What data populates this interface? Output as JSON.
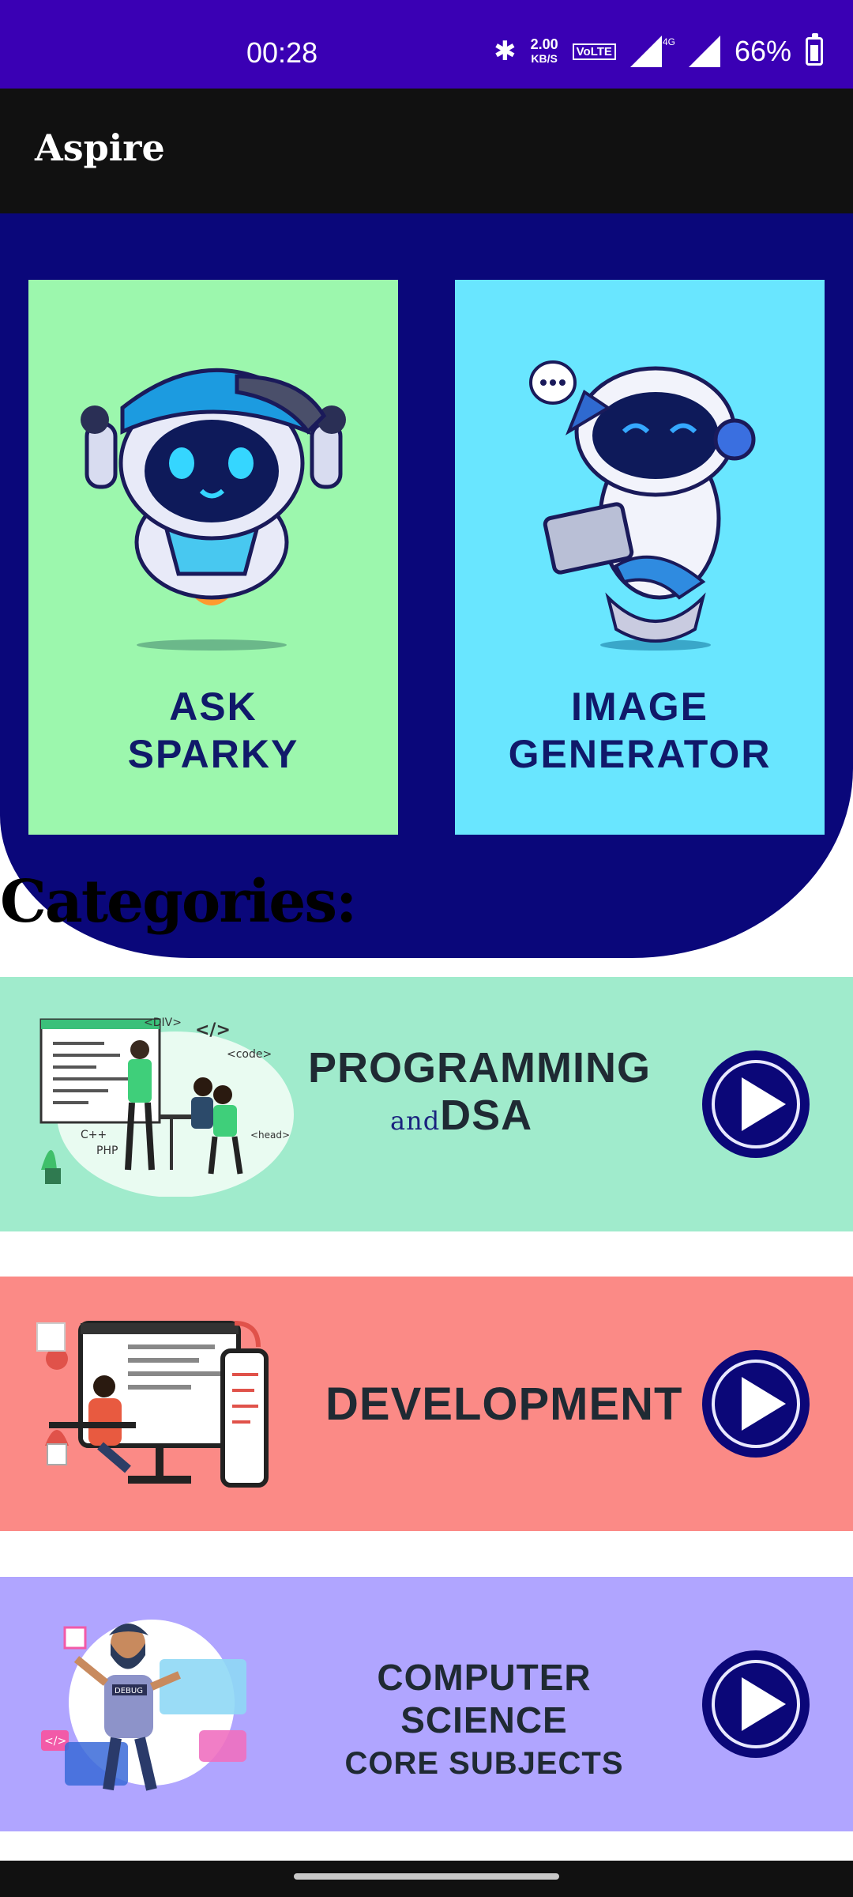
{
  "status_bar": {
    "time": "00:28",
    "data_speed": "2.00",
    "data_unit": "KB/S",
    "volte_label": "Vo LTE 2",
    "network": "4G+",
    "battery": "66%",
    "bg_color": "#3a00b4"
  },
  "app_bar": {
    "title": "Aspire"
  },
  "hero": {
    "cards": [
      {
        "line1": "ASK",
        "line2": "SPARKY",
        "bg": "#9cf7ad",
        "icon": "rocket-robot-icon"
      },
      {
        "line1": "IMAGE",
        "line2": "GENERATOR",
        "bg": "#69e6ff",
        "icon": "laptop-robot-icon"
      }
    ]
  },
  "categories": {
    "heading": "Categories:",
    "items": [
      {
        "title_line1": "PROGRAMMING",
        "title_small": "and",
        "title_line2": "DSA",
        "bg": "#a0ebcc",
        "code_tags": [
          "<DIV>",
          "</>",
          "<code>",
          "C++",
          "PHP",
          "<head>"
        ]
      },
      {
        "title_line1": "DEVELOPMENT",
        "bg": "#fb8a86"
      },
      {
        "title_line1": "COMPUTER SCIENCE",
        "title_line2": "CORE SUBJECTS",
        "bg": "#b0a5ff",
        "code_tags": [
          "</>",
          "DEBUG"
        ]
      }
    ]
  }
}
